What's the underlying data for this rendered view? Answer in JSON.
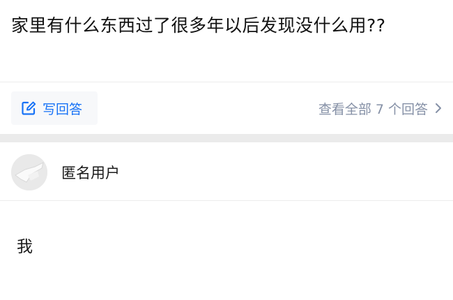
{
  "question": {
    "title": "家里有什么东西过了很多年以后发现没什么用??"
  },
  "actions": {
    "write_answer_label": "写回答",
    "view_all_label": "查看全部 7 个回答",
    "accent_color": "#1772f6",
    "muted_color": "#8590a6"
  },
  "answer": {
    "author_name": "匿名用户",
    "content": "我"
  },
  "icons": {
    "write": "edit-icon",
    "more": "chevron-right-icon"
  }
}
